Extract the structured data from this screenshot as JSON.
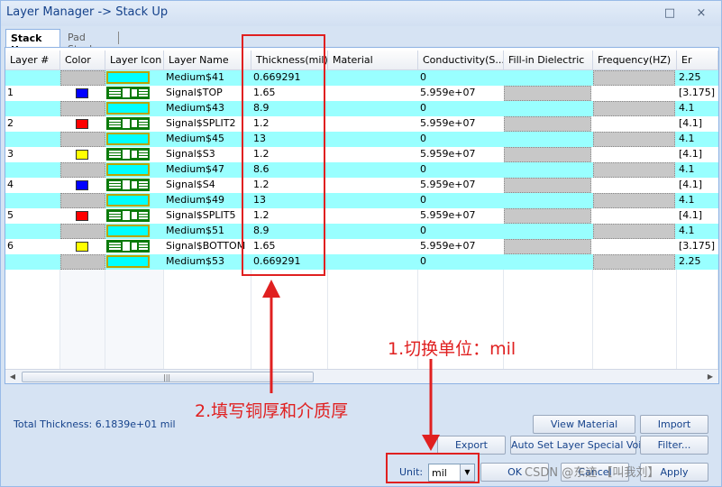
{
  "window": {
    "title": "Layer Manager -> Stack Up",
    "maximize_icon": "maximize-icon",
    "close_icon": "close-icon",
    "maximize_glyph": "□",
    "close_glyph": "×"
  },
  "tabs": [
    {
      "label": "Stack Up",
      "active": true
    },
    {
      "label": "Pad Stack",
      "active": false
    }
  ],
  "columns": [
    "Layer #",
    "Color",
    "Layer Icon",
    "Layer Name",
    "Thickness(mil)",
    "Material",
    "Conductivity(S...",
    "Fill-in Dielectric",
    "Frequency(HZ)",
    "Er"
  ],
  "rows": [
    {
      "num": "",
      "color": "",
      "type": "dielectric",
      "name": "Medium$41",
      "thickness": "0.669291",
      "conductivity": "0",
      "er": "2.25"
    },
    {
      "num": "1",
      "color": "#0000ff",
      "type": "signal",
      "name": "Signal$TOP",
      "thickness": "1.65",
      "conductivity": "5.959e+07",
      "er": "[3.175]"
    },
    {
      "num": "",
      "color": "",
      "type": "dielectric",
      "name": "Medium$43",
      "thickness": "8.9",
      "conductivity": "0",
      "er": "4.1"
    },
    {
      "num": "2",
      "color": "#ff0000",
      "type": "signal",
      "name": "Signal$SPLIT2",
      "thickness": "1.2",
      "conductivity": "5.959e+07",
      "er": "[4.1]"
    },
    {
      "num": "",
      "color": "",
      "type": "dielectric",
      "name": "Medium$45",
      "thickness": "13",
      "conductivity": "0",
      "er": "4.1"
    },
    {
      "num": "3",
      "color": "#ffff00",
      "type": "signal",
      "name": "Signal$S3",
      "thickness": "1.2",
      "conductivity": "5.959e+07",
      "er": "[4.1]"
    },
    {
      "num": "",
      "color": "",
      "type": "dielectric",
      "name": "Medium$47",
      "thickness": "8.6",
      "conductivity": "0",
      "er": "4.1"
    },
    {
      "num": "4",
      "color": "#0000ff",
      "type": "signal",
      "name": "Signal$S4",
      "thickness": "1.2",
      "conductivity": "5.959e+07",
      "er": "[4.1]"
    },
    {
      "num": "",
      "color": "",
      "type": "dielectric",
      "name": "Medium$49",
      "thickness": "13",
      "conductivity": "0",
      "er": "4.1"
    },
    {
      "num": "5",
      "color": "#ff0000",
      "type": "signal",
      "name": "Signal$SPLIT5",
      "thickness": "1.2",
      "conductivity": "5.959e+07",
      "er": "[4.1]"
    },
    {
      "num": "",
      "color": "",
      "type": "dielectric",
      "name": "Medium$51",
      "thickness": "8.9",
      "conductivity": "0",
      "er": "4.1"
    },
    {
      "num": "6",
      "color": "#ffff00",
      "type": "signal",
      "name": "Signal$BOTTOM",
      "thickness": "1.65",
      "conductivity": "5.959e+07",
      "er": "[3.175]"
    },
    {
      "num": "",
      "color": "",
      "type": "dielectric",
      "name": "Medium$53",
      "thickness": "0.669291",
      "conductivity": "0",
      "er": "2.25"
    }
  ],
  "colors": {
    "dielectric_row": "#99ffff",
    "signal_row": "#ffffff",
    "annotation": "#e02020"
  },
  "scrollbar": {
    "left_glyph": "◀",
    "right_glyph": "▶",
    "grip": "|||"
  },
  "footer": {
    "total_thickness": "Total Thickness:  6.1839e+01 mil",
    "buttons": {
      "view_material": "View Material",
      "import": "Import",
      "export": "Export",
      "auto_set": "Auto Set Layer Special Void",
      "filter": "Filter...",
      "ok": "OK",
      "cancel": "Cancel",
      "apply": "Apply"
    },
    "unit_label": "Unit:",
    "unit_value": "mil",
    "unit_arrow": "▼"
  },
  "annotations": {
    "step1": "1.切换单位：mil",
    "step2": "2.填写铜厚和介质厚"
  },
  "watermark": "CSDN @东迹 【叫我刘】"
}
